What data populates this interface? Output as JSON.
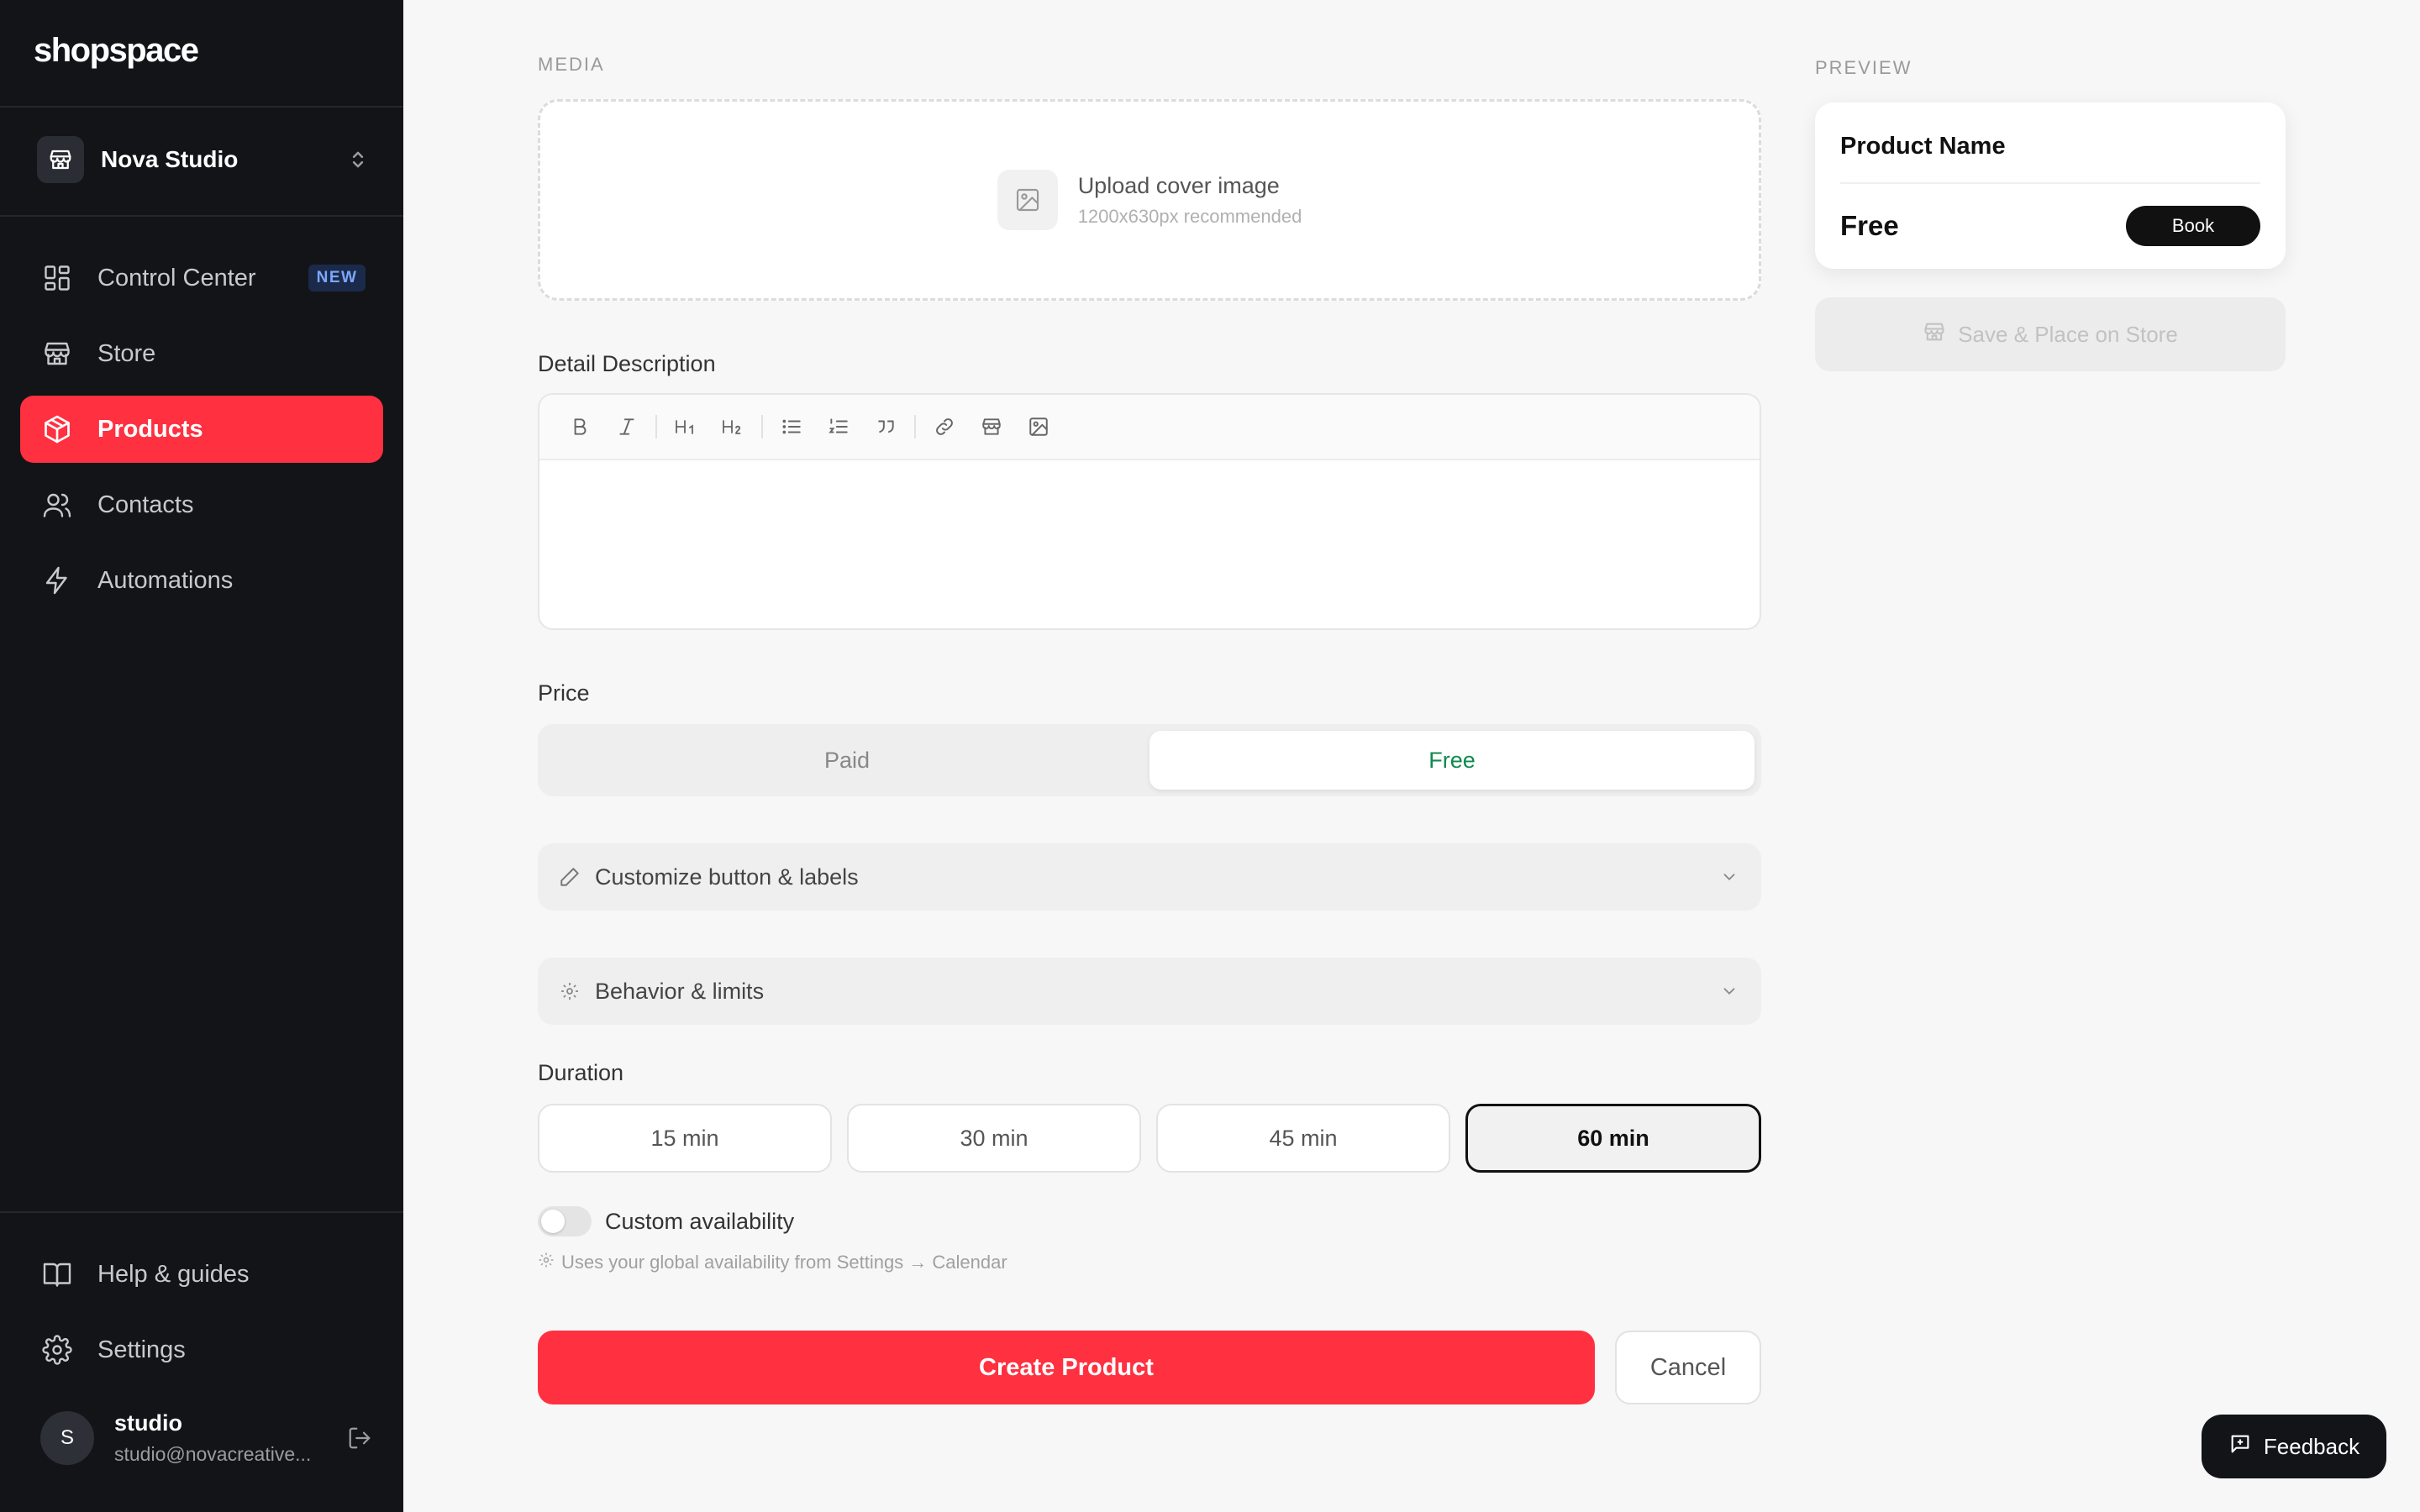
{
  "brand": {
    "logo": "shopspace"
  },
  "workspace": {
    "name": "Nova Studio"
  },
  "nav": {
    "items": [
      {
        "label": "Control Center",
        "badge": "NEW"
      },
      {
        "label": "Store"
      },
      {
        "label": "Products"
      },
      {
        "label": "Contacts"
      },
      {
        "label": "Automations"
      }
    ],
    "bottom": [
      {
        "label": "Help & guides"
      },
      {
        "label": "Settings"
      }
    ]
  },
  "user": {
    "initial": "S",
    "name": "studio",
    "email": "studio@novacreative..."
  },
  "media": {
    "section_label": "MEDIA",
    "upload_title": "Upload cover image",
    "upload_hint": "1200x630px recommended"
  },
  "description": {
    "label": "Detail Description",
    "toolbar": [
      "B",
      "I",
      "H1",
      "H2"
    ]
  },
  "price": {
    "label": "Price",
    "options": [
      "Paid",
      "Free"
    ],
    "selected": "Free"
  },
  "accordions": [
    {
      "label": "Customize button & labels"
    },
    {
      "label": "Behavior & limits"
    }
  ],
  "duration": {
    "label": "Duration",
    "options": [
      "15 min",
      "30 min",
      "45 min",
      "60 min"
    ],
    "selected": "60 min"
  },
  "availability": {
    "label": "Custom availability",
    "enabled": false,
    "hint": "Uses your global availability from Settings → Calendar"
  },
  "actions": {
    "create": "Create Product",
    "cancel": "Cancel"
  },
  "preview": {
    "section_label": "PREVIEW",
    "product_name": "Product Name",
    "price": "Free",
    "book_label": "Book",
    "save_label": "Save & Place on Store"
  },
  "feedback": {
    "label": "Feedback"
  },
  "colors": {
    "accent": "#ff3040",
    "sidebar": "#121418",
    "free_green": "#0f8a4f"
  }
}
